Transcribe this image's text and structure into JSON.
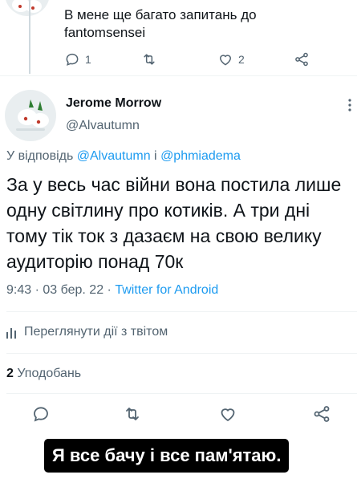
{
  "previous_tweet": {
    "text_line1": "В мене ще багато запитань до",
    "text_line2": "fantomsensei",
    "actions": {
      "reply_count": "1",
      "retweet_count": "",
      "like_count": "2"
    }
  },
  "tweet": {
    "author_name": "Jerome Morrow",
    "author_handle": "@Alvautumn",
    "reply_prefix": "У відповідь",
    "reply_handle_1": "@Alvautumn",
    "reply_joiner": "і",
    "reply_handle_2": "@phmiadema",
    "text": "За у весь час війни вона постила лише одну світлину про котиків. А три дні тому тік ток з дазаєм на свою велику аудиторію понад 70к",
    "time": "9:43",
    "date": "03 бер. 22",
    "separator": "·",
    "source": "Twitter for Android",
    "analytics_label": "Переглянути дії з твітом",
    "likes_count": "2",
    "likes_label": "Уподобань"
  },
  "caption": "Я все бачу і все пам'ятаю.",
  "colors": {
    "link": "#1d9bf0",
    "secondary": "#536471",
    "text": "#0f1419",
    "divider": "#eff3f4"
  }
}
